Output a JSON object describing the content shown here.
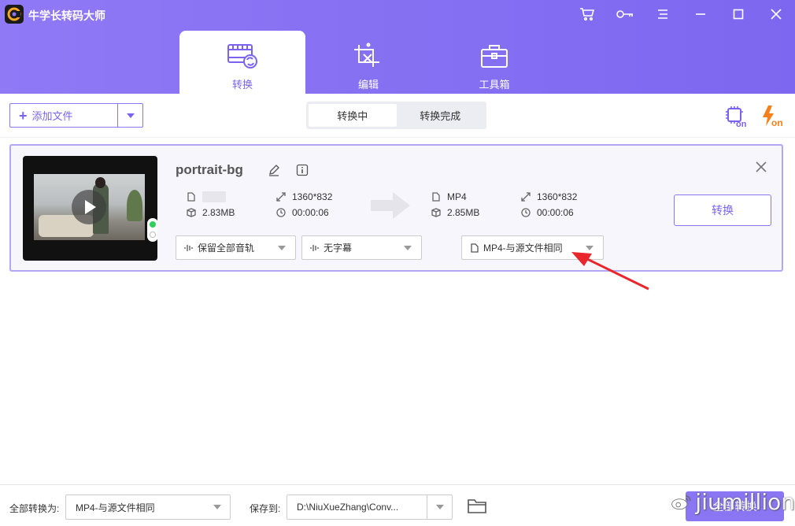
{
  "app": {
    "title": "牛学长转码大师"
  },
  "tabs": [
    {
      "label": "转换",
      "icon": "film-convert-icon",
      "active": true
    },
    {
      "label": "编辑",
      "icon": "crop-edit-icon",
      "active": false
    },
    {
      "label": "工具箱",
      "icon": "toolbox-icon",
      "active": false
    }
  ],
  "toolbar": {
    "add_file_label": "添加文件",
    "segments": [
      {
        "label": "转换中",
        "active": true
      },
      {
        "label": "转换完成",
        "active": false
      }
    ],
    "hw_accel_icon": "gpu-on-icon",
    "speed_icon": "lightning-on-icon"
  },
  "job": {
    "filename": "portrait-bg",
    "source": {
      "format": "",
      "size": "2.83MB",
      "resolution": "1360*832",
      "duration": "00:00:06"
    },
    "target": {
      "format": "MP4",
      "size": "2.85MB",
      "resolution": "1360*832",
      "duration": "00:00:06"
    },
    "audio_track": "保留全部音轨",
    "subtitle": "无字幕",
    "output_format": "MP4-与源文件相同",
    "convert_label": "转换"
  },
  "bottom": {
    "convert_all_label": "全部转换为:",
    "convert_all_value": "MP4-与源文件相同",
    "save_to_label": "保存到:",
    "save_path": "D:\\NiuXueZhang\\Conv...",
    "start_label": "全部转换"
  },
  "watermark": "jiumillion",
  "colors": {
    "accent": "#7b63f0",
    "header": "#8a76f2",
    "annotation": "#e8262c"
  }
}
